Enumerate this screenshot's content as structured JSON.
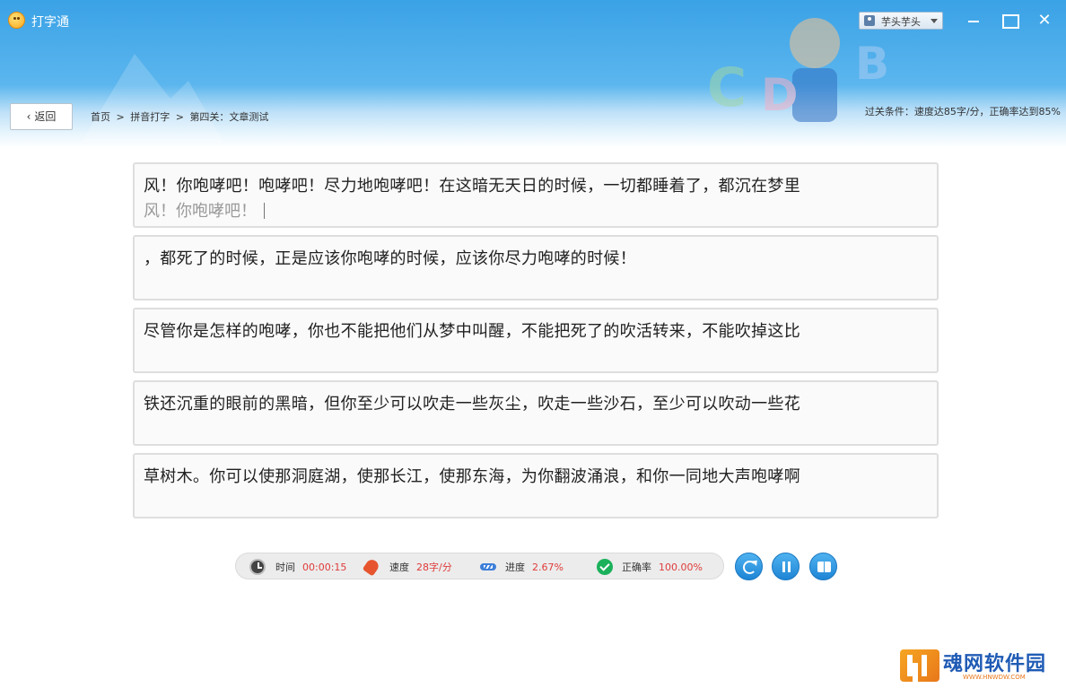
{
  "window": {
    "title": "打字通",
    "user": "芋头芋头"
  },
  "nav": {
    "back_label": "返回",
    "breadcrumb": [
      "首页",
      ">",
      "拼音打字",
      ">",
      "第四关：文章测试"
    ],
    "condition": "过关条件：速度达85字/分，正确率达到85%"
  },
  "lines": [
    {
      "source": "风！你咆哮吧！咆哮吧！尽力地咆哮吧！在这暗无天日的时候，一切都睡着了，都沉在梦里",
      "typed": "风！你咆哮吧！"
    },
    {
      "source": "，都死了的时候，正是应该你咆哮的时候，应该你尽力咆哮的时候！",
      "typed": ""
    },
    {
      "source": "尽管你是怎样的咆哮，你也不能把他们从梦中叫醒，不能把死了的吹活转来，不能吹掉这比",
      "typed": ""
    },
    {
      "source": "铁还沉重的眼前的黑暗，但你至少可以吹走一些灰尘，吹走一些沙石，至少可以吹动一些花",
      "typed": ""
    },
    {
      "source": "草树木。你可以使那洞庭湖，使那长江，使那东海，为你翻波涌浪，和你一同地大声咆哮啊",
      "typed": ""
    }
  ],
  "stats": {
    "time_label": "时间",
    "time_value": "00:00:15",
    "speed_label": "速度",
    "speed_value": "28字/分",
    "progress_label": "进度",
    "progress_value": "2.67%",
    "accuracy_label": "正确率",
    "accuracy_value": "100.00%",
    "value_color": "#e03a3a"
  },
  "watermark": {
    "text": "魂网软件园",
    "sub": "WWW.HNWDW.COM"
  }
}
